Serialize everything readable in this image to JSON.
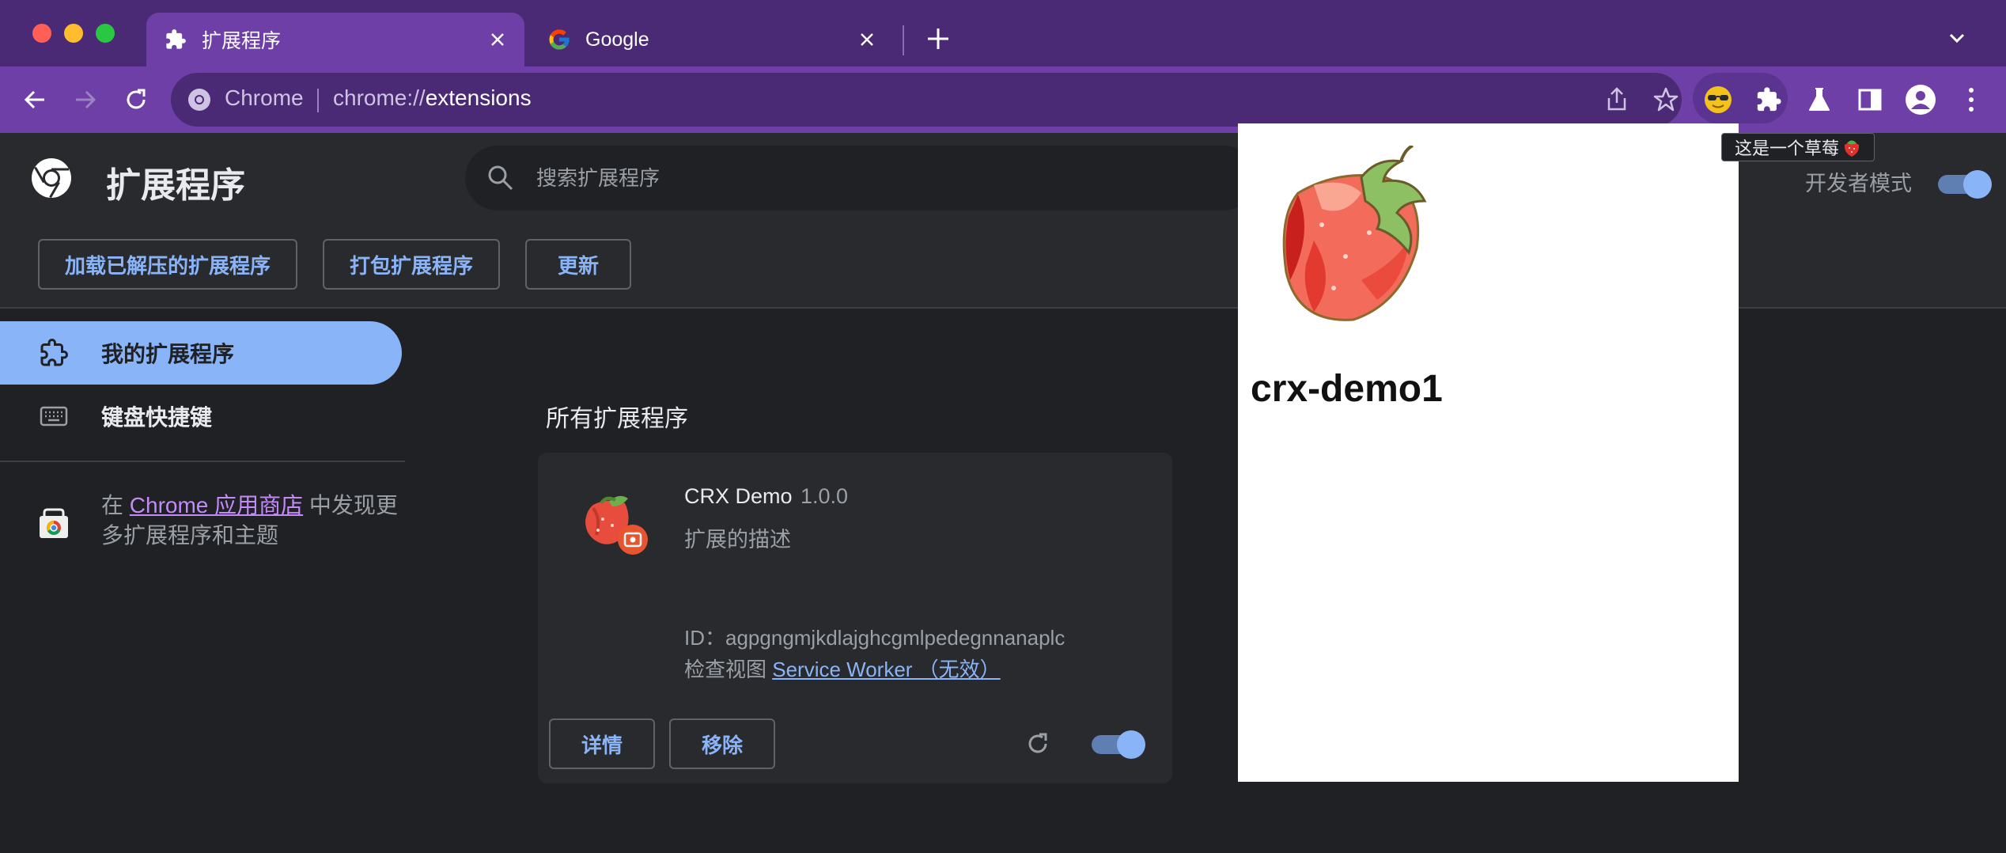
{
  "browser": {
    "tabs": [
      {
        "title": "扩展程序",
        "icon": "puzzle-icon",
        "active": true
      },
      {
        "title": "Google",
        "icon": "google-icon",
        "active": false
      }
    ],
    "omnibox": {
      "chip": "Chrome",
      "url_scheme": "chrome://",
      "url_host": "extensions"
    },
    "tooltip": "这是一个草莓"
  },
  "page": {
    "title": "扩展程序",
    "search_placeholder": "搜索扩展程序",
    "dev_mode_label": "开发者模式",
    "dev_mode_on": true,
    "actions": {
      "load_unpacked": "加载已解压的扩展程序",
      "pack": "打包扩展程序",
      "update": "更新"
    }
  },
  "sidebar": {
    "items": [
      {
        "label": "我的扩展程序",
        "icon": "extension-icon",
        "active": true
      },
      {
        "label": "键盘快捷键",
        "icon": "keyboard-icon",
        "active": false
      }
    ],
    "store": {
      "prefix": "在 ",
      "link": "Chrome 应用商店",
      "suffix": " 中发现更多扩展程序和主题"
    }
  },
  "main": {
    "section_title": "所有扩展程序",
    "extension": {
      "name": "CRX Demo",
      "version": "1.0.0",
      "description": "扩展的描述",
      "id_label": "ID：",
      "id": "agpgngmjkdlajghcgmlpedegnnanaplc",
      "inspect_label": "检查视图 ",
      "inspect_link": "Service Worker （无效）",
      "details_btn": "详情",
      "remove_btn": "移除",
      "enabled": true
    }
  },
  "popup": {
    "title": "crx-demo1"
  },
  "colors": {
    "tab_strip": "#4a2a74",
    "toolbar": "#6f3fa8",
    "accent": "#8ab4f8",
    "page_bg": "#202124",
    "card_bg": "#292a2d"
  }
}
